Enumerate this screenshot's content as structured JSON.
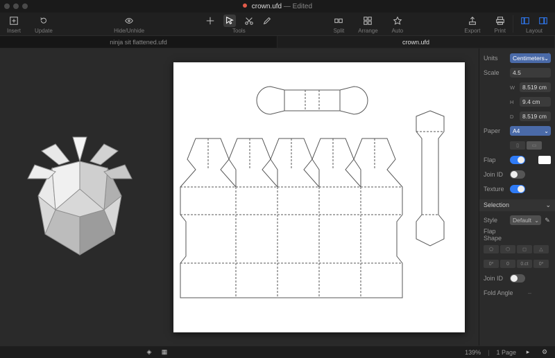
{
  "window": {
    "filename": "crown.ufd",
    "edited_suffix": "— Edited"
  },
  "toolbar": {
    "insert": "Insert",
    "update": "Update",
    "hide": "Hide/Unhide",
    "tools": "Tools",
    "split": "Split",
    "arrange": "Arrange",
    "auto": "Auto",
    "export": "Export",
    "print": "Print",
    "layout": "Layout"
  },
  "tabs": [
    {
      "label": "ninja sit flattened.ufd",
      "active": false
    },
    {
      "label": "crown.ufd",
      "active": true
    }
  ],
  "panel": {
    "units_label": "Units",
    "units_value": "Centimeters",
    "scale_label": "Scale",
    "scale_value": "4.5",
    "dim_w": "8.519 cm",
    "dim_h": "9.4 cm",
    "dim_d": "8.519 cm",
    "w": "W",
    "h": "H",
    "d": "D",
    "paper_label": "Paper",
    "paper_value": "A4",
    "flap_label": "Flap",
    "joinid_label": "Join ID",
    "texture_label": "Texture",
    "selection_hdr": "Selection",
    "style_label": "Style",
    "style_value": "Default",
    "flap_shape_label": "Flap Shape",
    "angles": [
      "0*",
      "0",
      "0.ct",
      "0*"
    ],
    "fold_angle_label": "Fold Angle"
  },
  "status": {
    "zoom": "139%",
    "pages": "1 Page"
  }
}
